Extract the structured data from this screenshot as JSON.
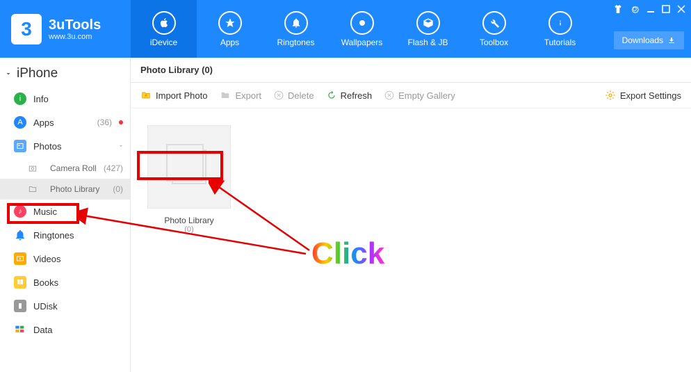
{
  "app": {
    "logo_number": "3",
    "title": "3uTools",
    "subtitle": "www.3u.com"
  },
  "topnav": {
    "tabs": [
      {
        "label": "iDevice"
      },
      {
        "label": "Apps"
      },
      {
        "label": "Ringtones"
      },
      {
        "label": "Wallpapers"
      },
      {
        "label": "Flash & JB"
      },
      {
        "label": "Toolbox"
      },
      {
        "label": "Tutorials"
      }
    ],
    "downloads": "Downloads"
  },
  "sidebar": {
    "device": "iPhone",
    "items": [
      {
        "label": "Info"
      },
      {
        "label": "Apps",
        "count": "(36)"
      },
      {
        "label": "Photos"
      },
      {
        "label": "Music"
      },
      {
        "label": "Ringtones"
      },
      {
        "label": "Videos"
      },
      {
        "label": "Books"
      },
      {
        "label": "UDisk"
      },
      {
        "label": "Data"
      }
    ],
    "subs": [
      {
        "label": "Camera Roll",
        "count": "(427)"
      },
      {
        "label": "Photo Library",
        "count": "(0)"
      }
    ]
  },
  "content": {
    "header": "Photo Library (0)",
    "toolbar": {
      "import": "Import Photo",
      "export": "Export",
      "delete": "Delete",
      "refresh": "Refresh",
      "empty": "Empty Gallery",
      "settings": "Export Settings"
    },
    "thumb": {
      "label": "Photo Library",
      "count": "(0)"
    }
  },
  "annotation": {
    "click": "Click"
  }
}
